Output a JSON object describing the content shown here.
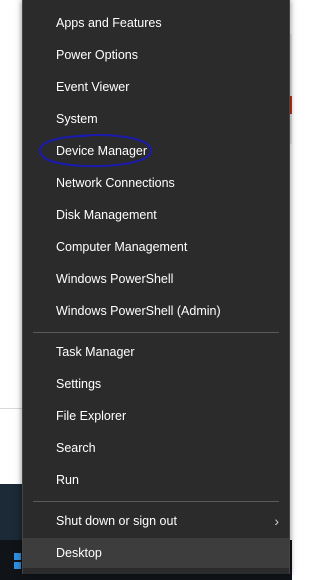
{
  "menu": {
    "items": [
      {
        "label": "Apps and Features"
      },
      {
        "label": "Power Options"
      },
      {
        "label": "Event Viewer"
      },
      {
        "label": "System"
      },
      {
        "label": "Device Manager"
      },
      {
        "label": "Network Connections"
      },
      {
        "label": "Disk Management"
      },
      {
        "label": "Computer Management"
      },
      {
        "label": "Windows PowerShell"
      },
      {
        "label": "Windows PowerShell (Admin)"
      },
      {
        "label": "Task Manager"
      },
      {
        "label": "Settings"
      },
      {
        "label": "File Explorer"
      },
      {
        "label": "Search"
      },
      {
        "label": "Run"
      },
      {
        "label": "Shut down or sign out"
      },
      {
        "label": "Desktop"
      }
    ],
    "shutdown_submenu_icon": "chevron-right-icon",
    "highlighted_item": "Desktop",
    "circled_item": "Device Manager"
  },
  "colors": {
    "menu_bg": "#2b2b2b",
    "menu_text": "#ffffff",
    "hover_bg": "#3d3d3d",
    "separator": "#5a5a5a",
    "annotation": "#1b1bb0"
  }
}
